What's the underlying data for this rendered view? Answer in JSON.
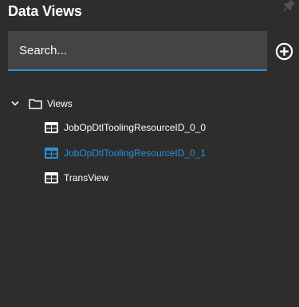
{
  "panel": {
    "title": "Data Views"
  },
  "search": {
    "placeholder": "Search...",
    "value": ""
  },
  "tree": {
    "root_label": "Views",
    "items": [
      {
        "label": "JobOpDtlToolingResourceID_0_0",
        "selected": false
      },
      {
        "label": "JobOpDtlToolingResourceID_0_1",
        "selected": true
      },
      {
        "label": "TransView",
        "selected": false
      }
    ]
  },
  "colors": {
    "background": "#2d2d2d",
    "search_background": "#444444",
    "accent": "#2e8fd6",
    "text": "#ffffff"
  },
  "icons": {
    "pin": "pin-icon",
    "add": "add-circle-icon",
    "expand": "chevron-down-icon",
    "folder": "folder-icon",
    "table": "table-icon"
  }
}
